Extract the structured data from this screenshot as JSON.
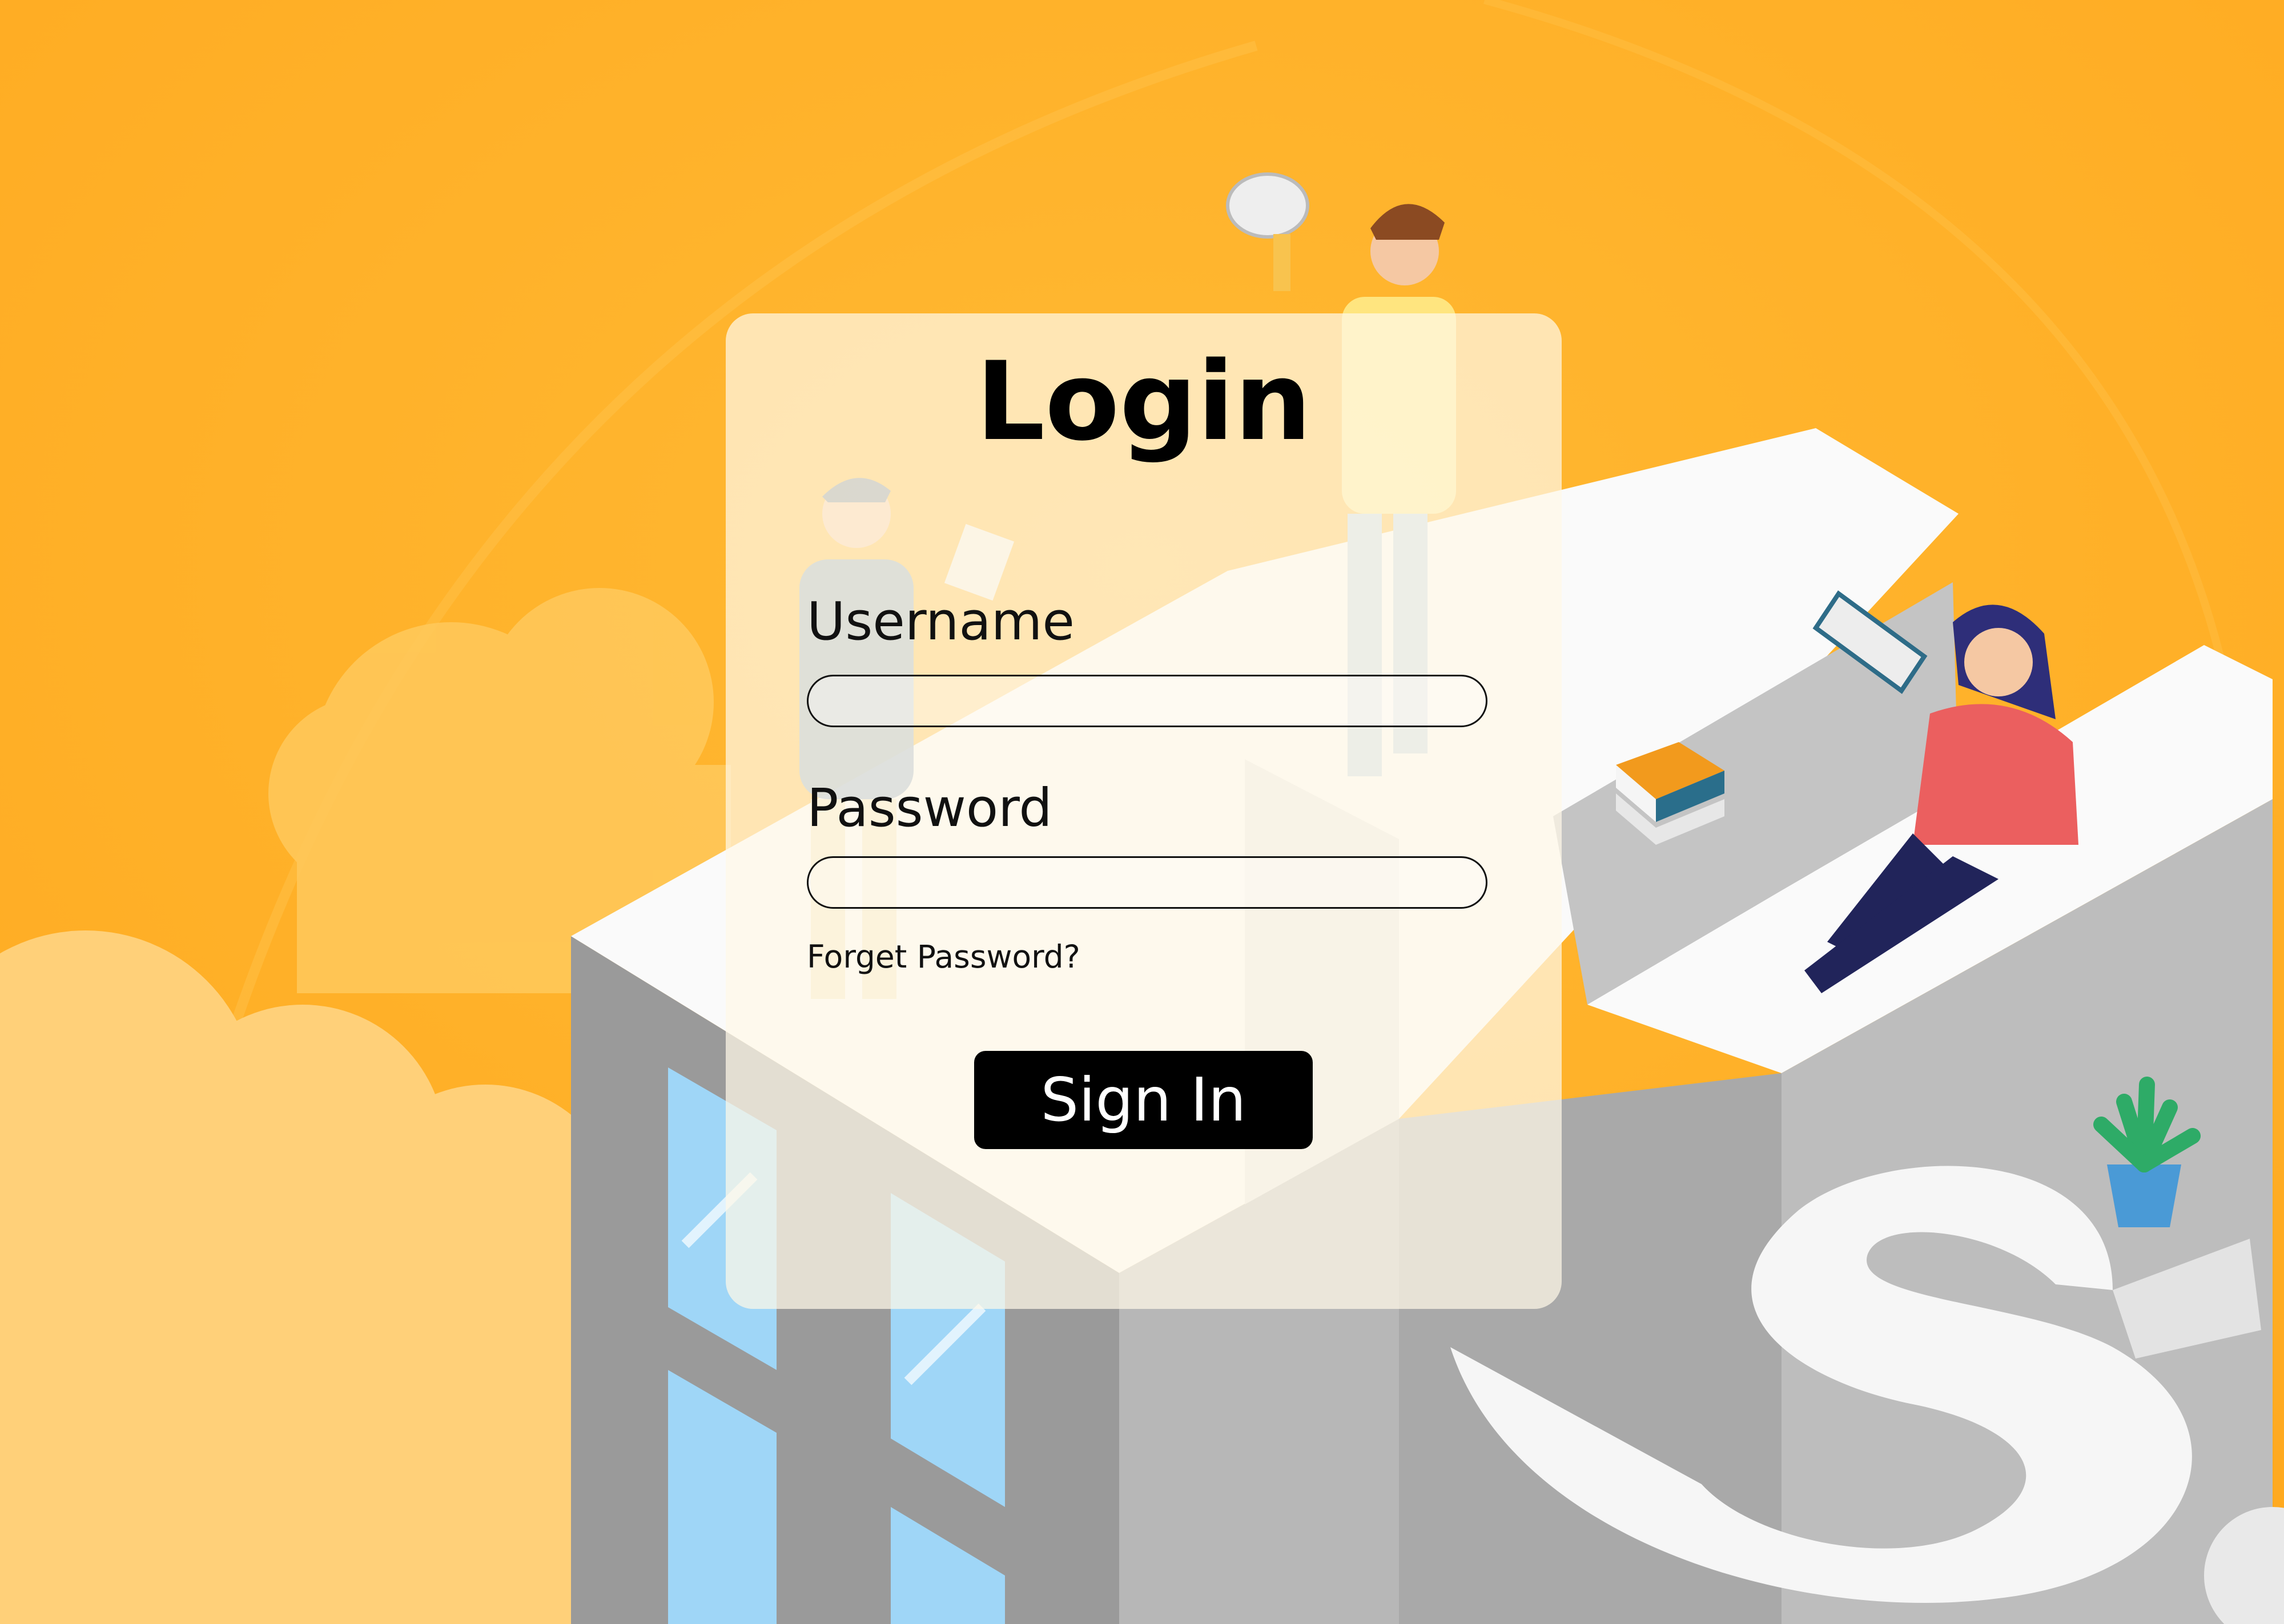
{
  "login": {
    "title": "Login",
    "username_label": "Username",
    "username_value": "",
    "password_label": "Password",
    "password_value": "",
    "forgot_password": "Forget Password?",
    "sign_in": "Sign In"
  },
  "colors": {
    "background": "#FFB22E",
    "card": "#FFF8E8",
    "button": "#000000",
    "button_text": "#FFFFFF"
  }
}
